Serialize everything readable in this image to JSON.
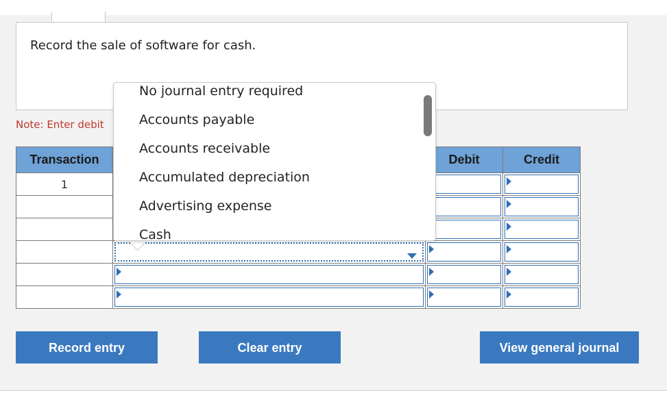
{
  "prompt": {
    "text": "Record the sale of software for cash."
  },
  "note": {
    "text": "Note: Enter debit"
  },
  "journal": {
    "headers": {
      "transaction": "Transaction",
      "debit": "Debit",
      "credit": "Credit"
    },
    "rows": [
      {
        "transaction": "1"
      },
      {
        "transaction": ""
      },
      {
        "transaction": ""
      },
      {
        "transaction": ""
      },
      {
        "transaction": ""
      },
      {
        "transaction": ""
      }
    ]
  },
  "dropdown": {
    "options": [
      "No journal entry required",
      "Accounts payable",
      "Accounts receivable",
      "Accumulated depreciation",
      "Advertising expense",
      "Cash"
    ]
  },
  "buttons": {
    "record": "Record entry",
    "clear": "Clear entry",
    "view": "View general journal"
  },
  "colors": {
    "header_bg": "#6fa2d6",
    "button_bg": "#3a79c0",
    "note_text": "#c0392b",
    "input_border": "#2f6db3"
  },
  "icons": {
    "dropdown_arrow": "caret-down-icon",
    "cell_marker": "triangle-right-icon"
  }
}
